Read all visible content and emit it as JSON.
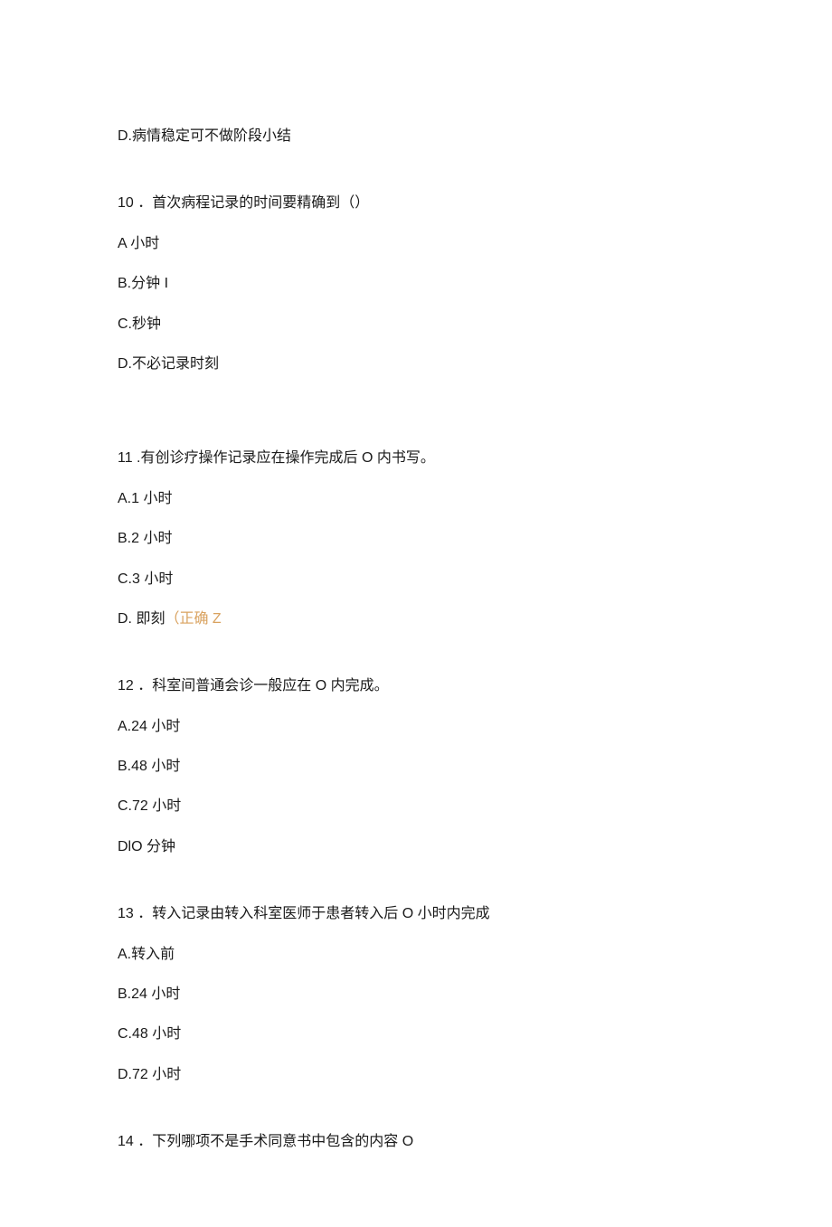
{
  "lines": {
    "q9d": "D.病情稳定可不做阶段小结",
    "q10": "10 ．首次病程记录的时间要精确到（）",
    "q10a": "A 小时",
    "q10b": "B.分钟 I",
    "q10c": "C.秒钟",
    "q10d": "D.不必记录时刻",
    "q11": "11 .有创诊疗操作记录应在操作完成后 O 内书写。",
    "q11a": "A.1 小时",
    "q11b": "B.2 小时",
    "q11c": "C.3 小时",
    "q11d_prefix": "D. 即刻",
    "q11d_suffix": "（正确 Z",
    "q12": "12 ．科室间普通会诊一般应在 O 内完成。",
    "q12a": "A.24 小时",
    "q12b": "B.48 小时",
    "q12c": "C.72 小时",
    "q12d": "DlO 分钟",
    "q13": "13 ．转入记录由转入科室医师于患者转入后 O 小时内完成",
    "q13a": "A.转入前",
    "q13b": "B.24 小时",
    "q13c": "C.48 小时",
    "q13d": "D.72 小时",
    "q14": "14 ．下列哪项不是手术同意书中包含的内容 O"
  }
}
